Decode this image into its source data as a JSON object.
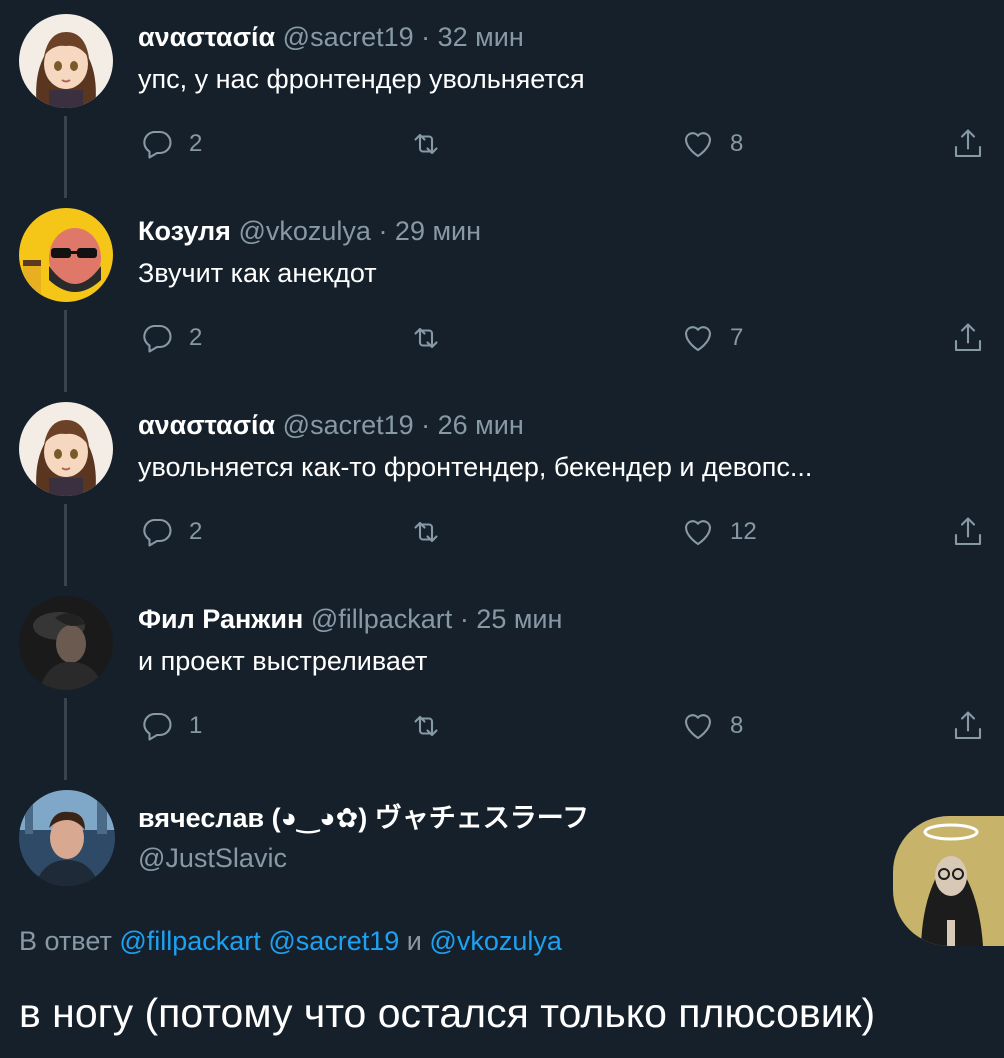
{
  "colors": {
    "background": "#15202b",
    "text_primary": "#ffffff",
    "text_secondary": "#8899a6",
    "link": "#1da1f2",
    "thread_line": "#38444d"
  },
  "icons": {
    "reply": "reply-icon",
    "retweet": "retweet-icon",
    "like": "heart-icon",
    "share": "share-icon"
  },
  "tweets": [
    {
      "name": "αναστασία",
      "handle": "@sacret19",
      "time": "· 32 мин",
      "text": "упс, у нас фронтендер увольняется",
      "replies": "2",
      "likes": "8"
    },
    {
      "name": "Козуля",
      "handle": "@vkozulya",
      "time": "· 29 мин",
      "text": "Звучит как анекдот",
      "replies": "2",
      "likes": "7"
    },
    {
      "name": "αναστασία",
      "handle": "@sacret19",
      "time": "· 26 мин",
      "text": "увольняется как-то фронтендер, бекендер и девопс...",
      "replies": "2",
      "likes": "12"
    },
    {
      "name": "Фил Ранжин",
      "handle": "@fillpackart",
      "time": "· 25 мин",
      "text": "и проект выстреливает",
      "replies": "1",
      "likes": "8"
    }
  ],
  "main_tweet": {
    "name": "вячеслав (◕‿◕✿) ヴャチェスラーフ",
    "handle": "@JustSlavic",
    "reply_prefix": "В ответ",
    "mention_1": "@fillpackart",
    "mention_2": "@sacret19",
    "conjunction": "и",
    "mention_3": "@vkozulya",
    "text": "в ногу (потому что остался только плюсовик)"
  }
}
